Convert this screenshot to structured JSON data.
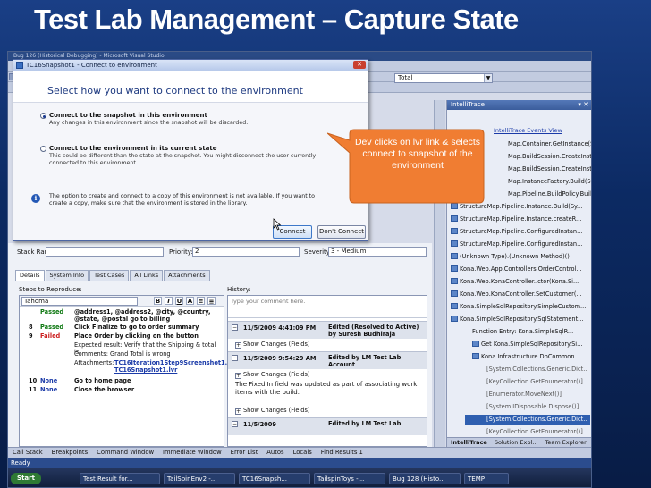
{
  "slide": {
    "title": "Test Lab Management – Capture State"
  },
  "vs": {
    "window_title": "Bug 126 (Historical Debugging) - Microsoft Visual Studio",
    "config_combo": "Total"
  },
  "dialog": {
    "title": "TC16Snapshot1 - Connect to environment",
    "heading": "Select how you want to connect to the environment",
    "option1_label": "Connect to the snapshot in this environment",
    "option1_desc": "Any changes in this environment since the snapshot will be discarded.",
    "option2_label": "Connect to the environment in its current state",
    "option2_desc": "This could be different than the state at the snapshot. You might disconnect the user currently connected to this environment.",
    "info_text": "The option to create and connect to a copy of this environment is not available. If you want to create a copy, make sure that the environment is stored in the library.",
    "connect_label": "Connect",
    "dont_connect_label": "Don't Connect"
  },
  "callout": {
    "text": "Dev clicks on lvr link & selects connect to snapshot of the environment",
    "color": "#f07d32"
  },
  "workitem": {
    "stack_rank_label": "Stack Rank:",
    "priority_label": "Priority:",
    "priority_value": "2",
    "severity_label": "Severity:",
    "severity_value": "3 - Medium",
    "tabs": [
      "Details",
      "System Info",
      "Test Cases",
      "All Links",
      "Attachments"
    ],
    "steps_label": "Steps to Reproduce:",
    "history_label": "History:",
    "font_value": "Tahoma",
    "steps": [
      {
        "num": "",
        "status": "Passed",
        "text": "@address1, @address2, @city, @country, @state, @postal go to billing"
      },
      {
        "num": "8",
        "status": "Passed",
        "text": "Click Finalize to go to order summary"
      },
      {
        "num": "9",
        "status": "Failed",
        "text": "Place Order by clicking on the button"
      },
      {
        "num": "",
        "status": "",
        "text": "Expected result: Verify that the Shipping & total is"
      },
      {
        "num": "",
        "status": "",
        "text": "Comments: Grand Total is wrong"
      },
      {
        "num": "",
        "status": "",
        "text": "Attachments:"
      },
      {
        "num": "10",
        "status": "None",
        "text": "Go to home page"
      },
      {
        "num": "11",
        "status": "None",
        "text": "Close the browser"
      }
    ],
    "attachment1": "TC16Iteration1Step9Screenshot1.p",
    "attachment2": "TC16Snapshot1.lvr",
    "history_placeholder": "Type your comment here.",
    "history": [
      {
        "date": "11/5/2009 4:41:09 PM",
        "edit": "Edited (Resolved to Active) by Suresh Budhiraja",
        "changes": "Show Changes (Fields)"
      },
      {
        "date": "11/5/2009 9:54:29 AM",
        "edit": "Edited by LM Test Lab Account",
        "changes": "Show Changes (Fields)",
        "body": "The Fixed In field was updated as part of associating work items with the build."
      },
      {
        "date": "11/5/2009",
        "edit": "Edited by LM Test Lab"
      }
    ]
  },
  "intellitrace": {
    "title": "IntelliTrace",
    "link": "IntelliTrace Events View",
    "rows": [
      "Map.Container.GetInstance(Sy...",
      "Map.BuildSession.CreateInstan...",
      "Map.BuildSession.CreateInstan...",
      "Map.InstanceFactory.Build(Str...",
      "Map.Pipeline.BuildPolicy.Build(S...",
      "StructureMap.Pipeline.Instance.Build(Sy...",
      "StructureMap.Pipeline.Instance.createR...",
      "StructureMap.Pipeline.ConfiguredInstan...",
      "StructureMap.Pipeline.ConfiguredInstan...",
      "(Unknown Type).(Unknown Method)()",
      "Kona.Web.App.Controllers.OrderControl...",
      "Kona.Web.KonaController..ctor(Kona.Si...",
      "Kona.Web.KonaController.SetCustomer(...",
      "Kona.SimpleSqlRepository.SimpleCustom...",
      "Kona.SimpleSqlRepository.SqlStatement...",
      "Function Entry: Kona.SimpleSqlR...",
      "Get Kona.SimpleSqlRepository.Si...",
      "Kona.Infrastructure.DbCommon...",
      "[System.Collections.Generic.Dict...",
      "[KeyCollection.GetEnumerator()]",
      "[Enumerator.MoveNext()]",
      "[System.IDisposable.Dispose()]",
      "[System.Collections.Generic.Dict...",
      "[KeyCollection.GetEnumerator()]",
      "[Enumerator.MoveNext()]"
    ],
    "bottom_tabs": [
      "IntelliTrace",
      "Solution Expl...",
      "Team Explorer"
    ]
  },
  "bottom_tabs": [
    "Call Stack",
    "Breakpoints",
    "Command Window",
    "Immediate Window",
    "Error List",
    "Autos",
    "Locals",
    "Find Results 1"
  ],
  "status": "Ready",
  "taskbar": {
    "start": "Start",
    "items": [
      "Test Result for...",
      "TailSpinEnv2 -...",
      "TC16Snapsh...",
      "TailspinToys -...",
      "Bug 128 (Histo...",
      "TEMP"
    ]
  }
}
